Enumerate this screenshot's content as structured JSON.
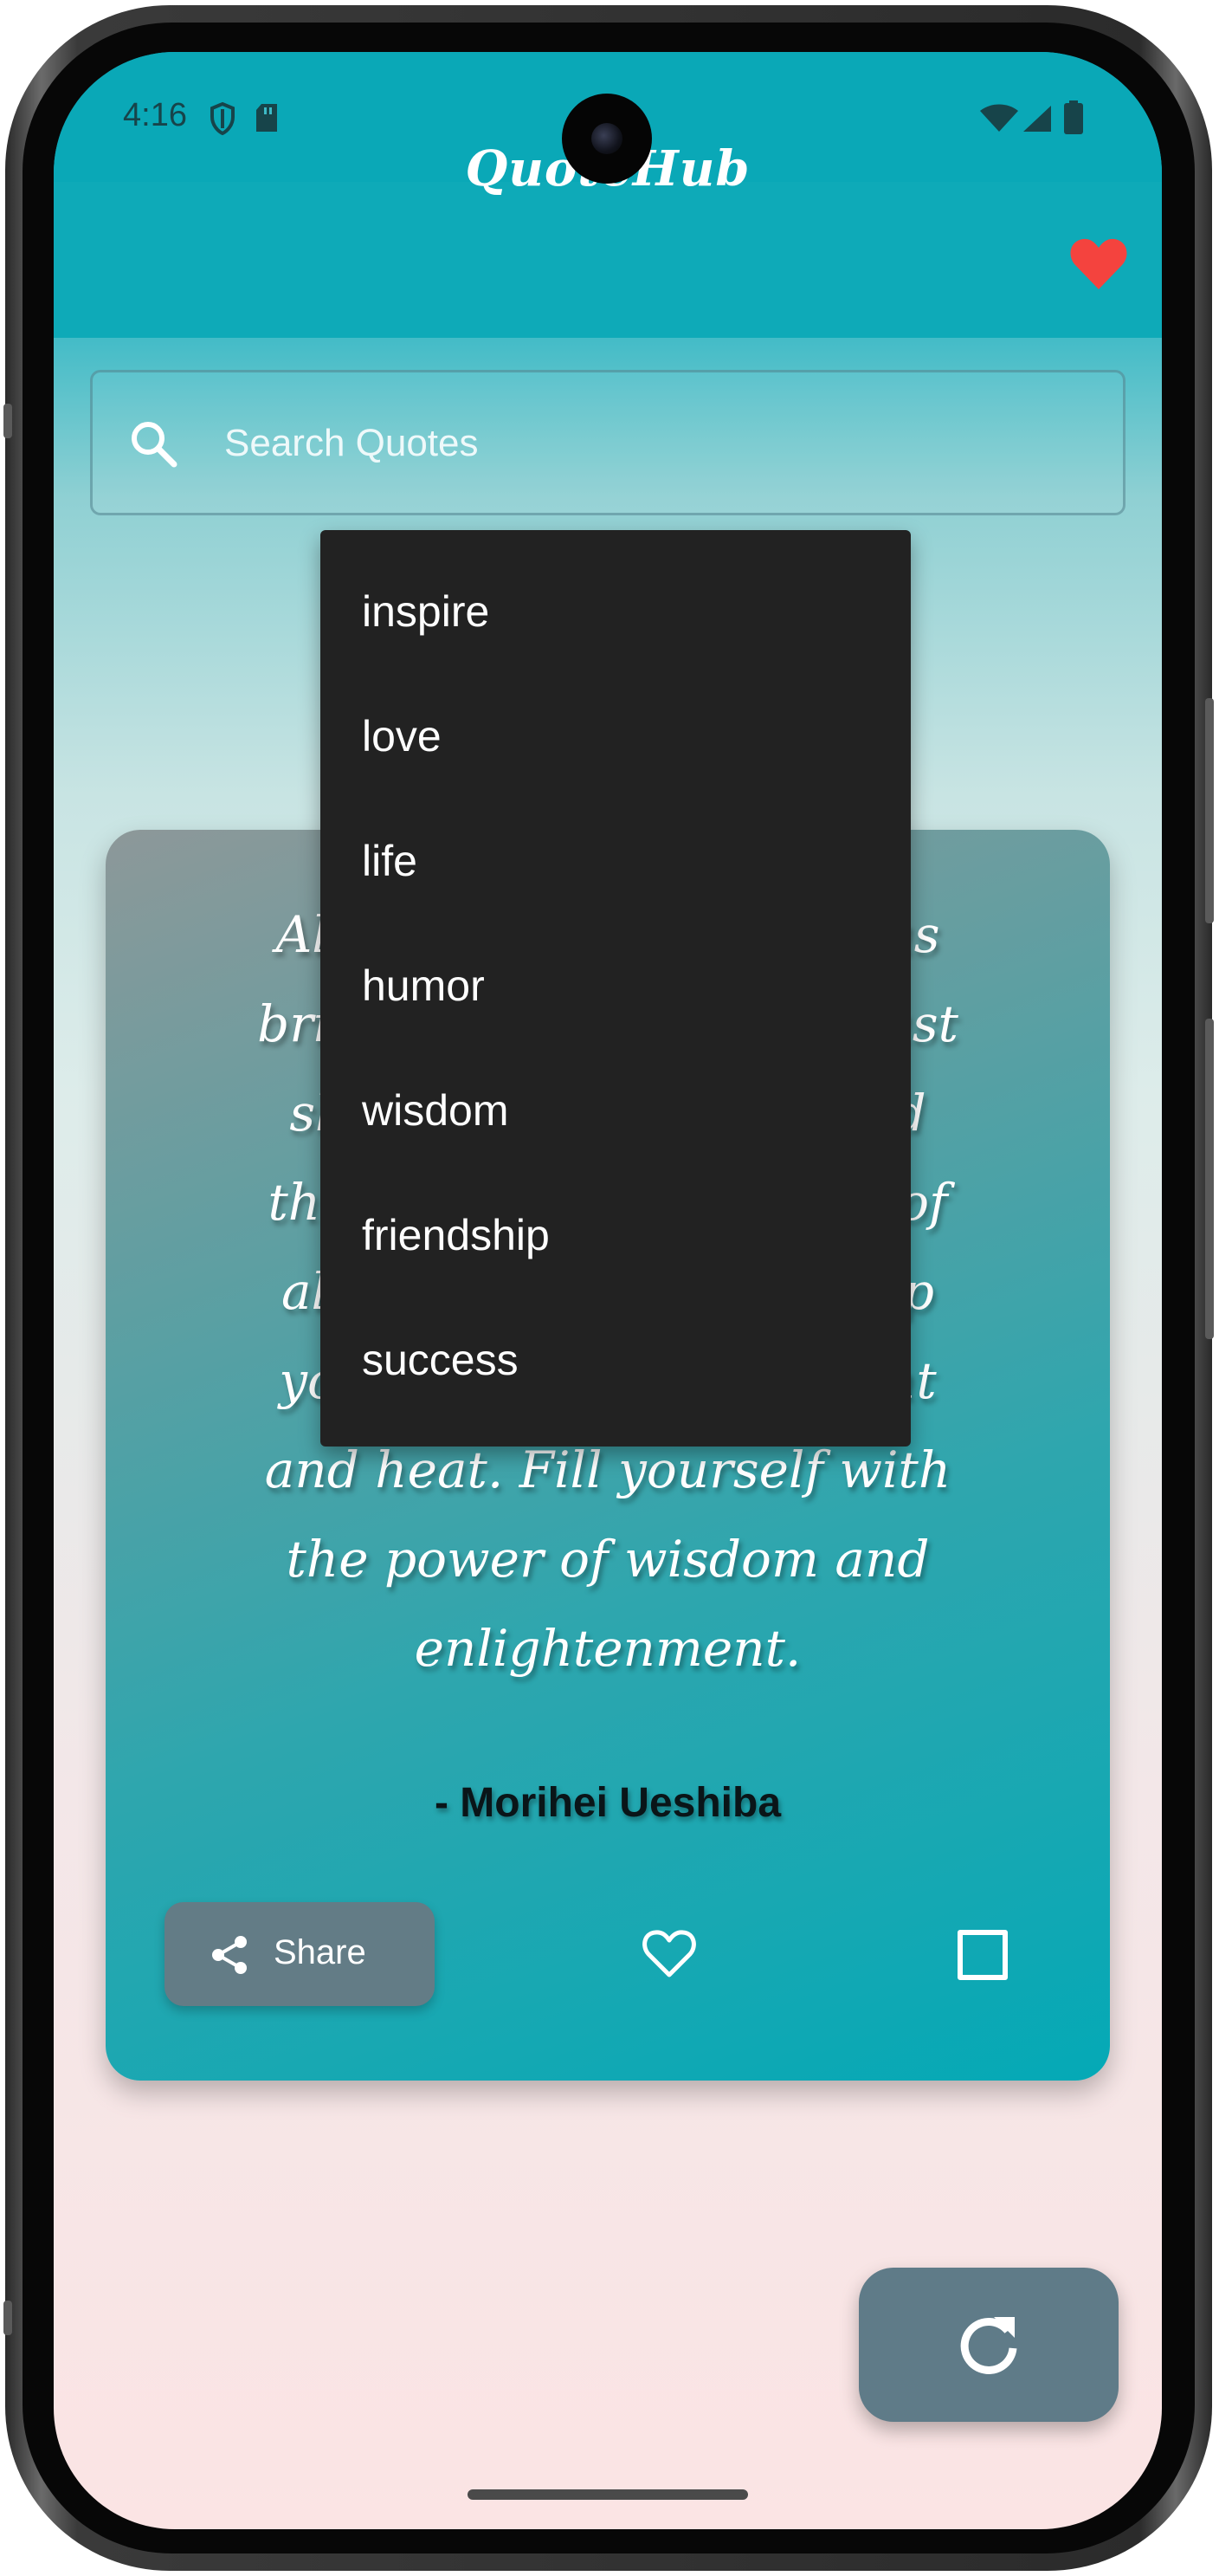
{
  "status_bar": {
    "time": "4:16",
    "icons": [
      "shield-icon",
      "sd-card-icon",
      "wifi-icon",
      "signal-icon",
      "battery-icon"
    ]
  },
  "app": {
    "title": "QuoteHub",
    "favorites_icon": "heart-icon",
    "accent_color": "#0eaab8",
    "heart_color": "#f4433e"
  },
  "search": {
    "placeholder": "Search Quotes",
    "value": ""
  },
  "dropdown": {
    "items": [
      "inspire",
      "love",
      "life",
      "humor",
      "wisdom",
      "friendship",
      "success"
    ]
  },
  "quote": {
    "lines": [
      "Always keep your mind as",
      "bright and clear as the vast",
      "sky, the great ocean, and",
      "the highest peak, empty of",
      "all thoughts. Always keep",
      "your body filled with light",
      "and heat. Fill yourself with",
      "the power of wisdom and",
      "enlightenment."
    ],
    "author": "- Morihei Ueshiba"
  },
  "actions": {
    "share_label": "Share"
  }
}
